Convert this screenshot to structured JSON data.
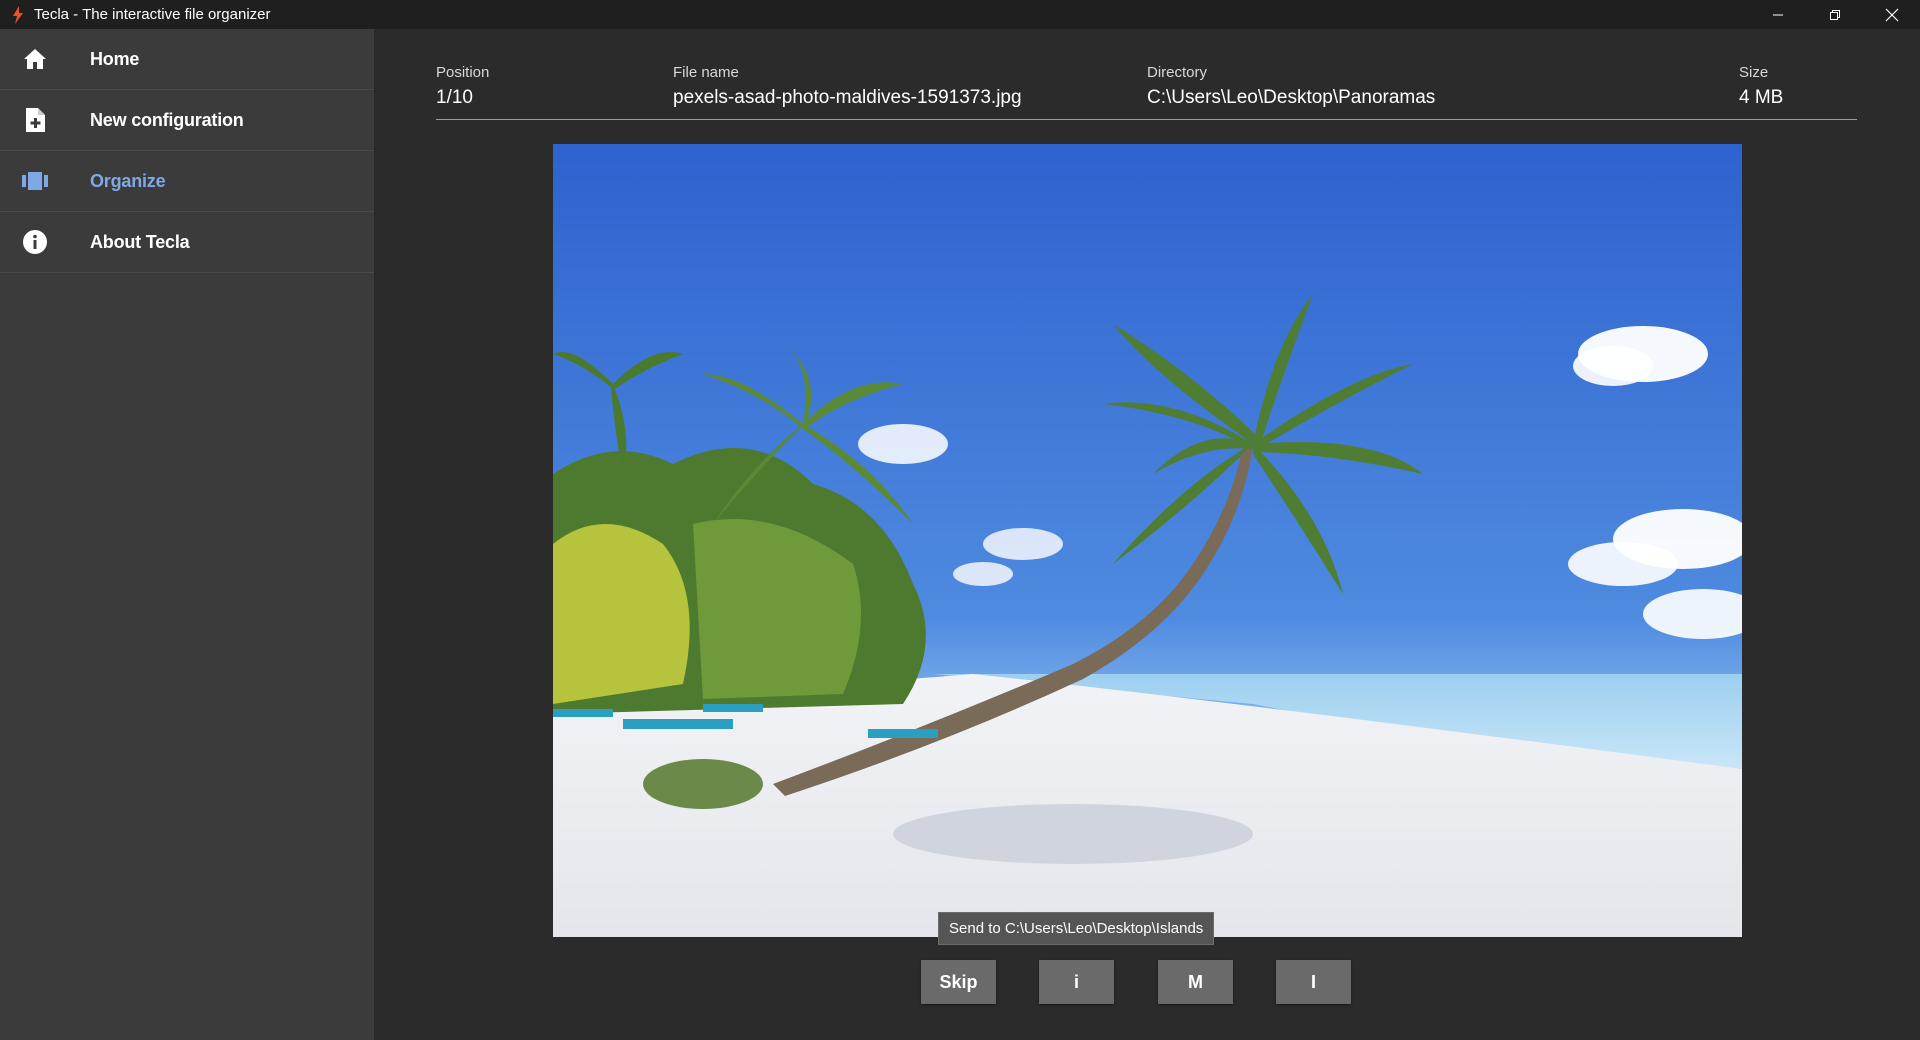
{
  "window": {
    "title": "Tecla - The interactive file organizer",
    "controls": [
      "minimize-icon",
      "restore-icon",
      "close-icon"
    ]
  },
  "sidebar": {
    "items": [
      {
        "label": "Home",
        "icon": "home-icon",
        "active": false
      },
      {
        "label": "New configuration",
        "icon": "new-file-icon",
        "active": false
      },
      {
        "label": "Organize",
        "icon": "organize-icon",
        "active": true
      },
      {
        "label": "About Tecla",
        "icon": "info-icon",
        "active": false
      }
    ],
    "active_color": "#7fa9e6"
  },
  "file_info": {
    "position_label": "Position",
    "position_value": "1/10",
    "filename_label": "File name",
    "filename_value": "pexels-asad-photo-maldives-1591373.jpg",
    "directory_label": "Directory",
    "directory_value": "C:\\Users\\Leo\\Desktop\\Panoramas",
    "size_label": "Size",
    "size_value": "4 MB"
  },
  "preview": {
    "description_icon": "image-preview"
  },
  "tooltip": {
    "text": "Send to C:\\Users\\Leo\\Desktop\\Islands"
  },
  "actions": {
    "buttons": [
      {
        "label": "Skip"
      },
      {
        "label": "i"
      },
      {
        "label": "M"
      },
      {
        "label": "I"
      }
    ]
  }
}
